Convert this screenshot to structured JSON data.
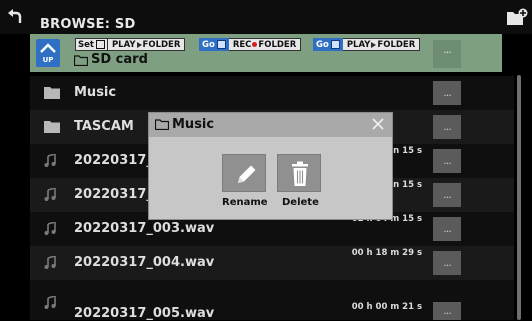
{
  "header": {
    "title": "BROWSE: SD",
    "back_icon": "back-arrow-icon",
    "new_folder_icon": "new-folder-icon"
  },
  "shortcuts": {
    "up_label": "UP",
    "current_folder": "SD card",
    "chips": [
      {
        "prefix": "Set",
        "label_a": "PLAY",
        "label_b": "FOLDER",
        "separator": "play-triangle"
      },
      {
        "prefix": "Go",
        "label_a": "REC",
        "label_b": "FOLDER",
        "separator": "rec-dot"
      },
      {
        "prefix": "Go",
        "label_a": "PLAY",
        "label_b": "FOLDER",
        "separator": "play-triangle"
      }
    ],
    "menu_label": "..."
  },
  "files": [
    {
      "name": "Music",
      "type": "folder",
      "duration": ""
    },
    {
      "name": "TASCAM",
      "type": "folder",
      "duration": ""
    },
    {
      "name": "20220317_0",
      "type": "audio",
      "duration": "n 15 s"
    },
    {
      "name": "20220317_0",
      "type": "audio",
      "duration": "n 15 s"
    },
    {
      "name": "20220317_003.wav",
      "type": "audio",
      "duration": "02 h 04 m 15 s"
    },
    {
      "name": "20220317_004.wav",
      "type": "audio",
      "duration": "00 h 18 m 29 s"
    },
    {
      "name": "20220317_005.wav",
      "type": "audio",
      "duration": "00 h 00 m 21 s"
    }
  ],
  "modal": {
    "title": "Music",
    "rename_label": "Rename",
    "delete_label": "Delete"
  },
  "colors": {
    "shortcut_bar": "#7e9f82",
    "go_blue": "#2f6fc4",
    "rec_red": "#d21f1f",
    "row_dark": "#0f0f0f",
    "row_light": "#1a1a1a"
  }
}
